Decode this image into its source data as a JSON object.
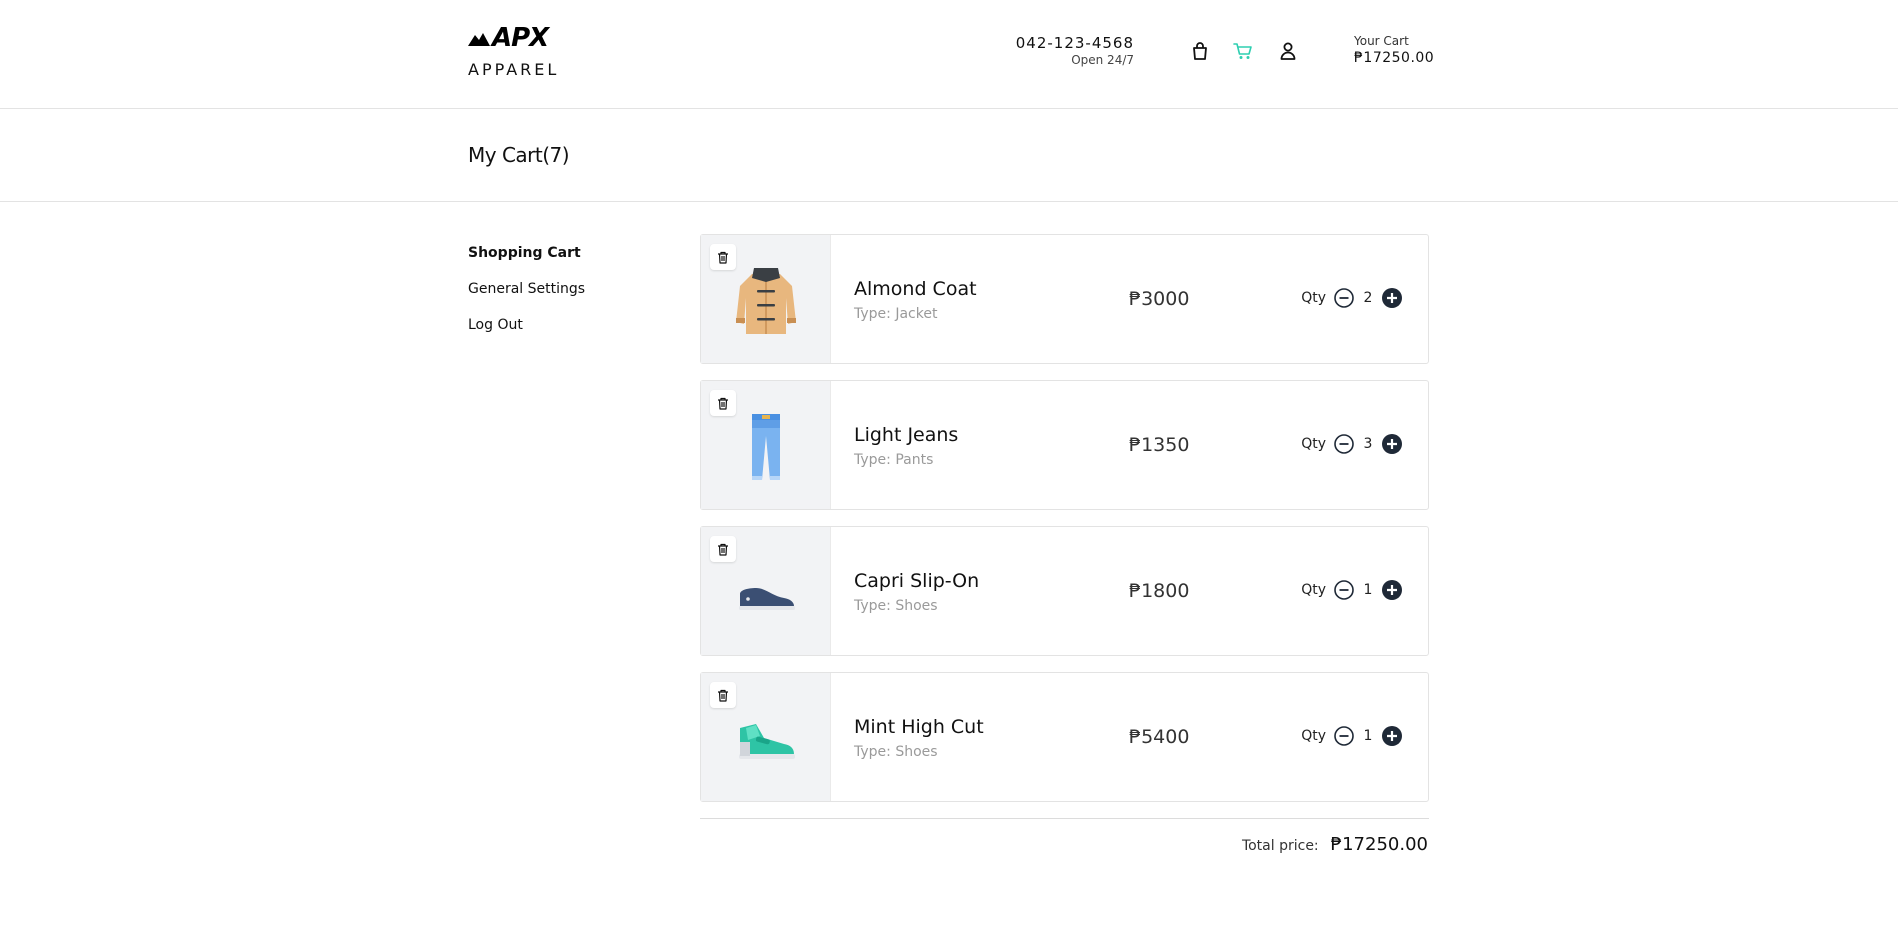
{
  "header": {
    "brand": "APX",
    "brand_sub": "APPAREL",
    "phone": "042-123-4568",
    "hours": "Open 24/7",
    "cart_label": "Your Cart",
    "cart_total": "₱17250.00",
    "icons": [
      "shopping-bag-icon",
      "cart-icon",
      "user-icon"
    ],
    "accent_color": "#2ecfb1"
  },
  "page": {
    "title": "My Cart(7)"
  },
  "sidebar": {
    "items": [
      {
        "label": "Shopping Cart",
        "active": true
      },
      {
        "label": "General Settings",
        "active": false
      },
      {
        "label": "Log Out",
        "active": false
      }
    ]
  },
  "cart": {
    "items": [
      {
        "name": "Almond Coat",
        "type": "Type: Jacket",
        "price": "₱3000",
        "qty_label": "Qty",
        "qty": "2"
      },
      {
        "name": "Light Jeans",
        "type": "Type: Pants",
        "price": "₱1350",
        "qty_label": "Qty",
        "qty": "3"
      },
      {
        "name": "Capri Slip-On",
        "type": "Type: Shoes",
        "price": "₱1800",
        "qty_label": "Qty",
        "qty": "1"
      },
      {
        "name": "Mint High Cut",
        "type": "Type: Shoes",
        "price": "₱5400",
        "qty_label": "Qty",
        "qty": "1"
      }
    ],
    "total_label": "Total price:",
    "total_value": "₱17250.00"
  }
}
